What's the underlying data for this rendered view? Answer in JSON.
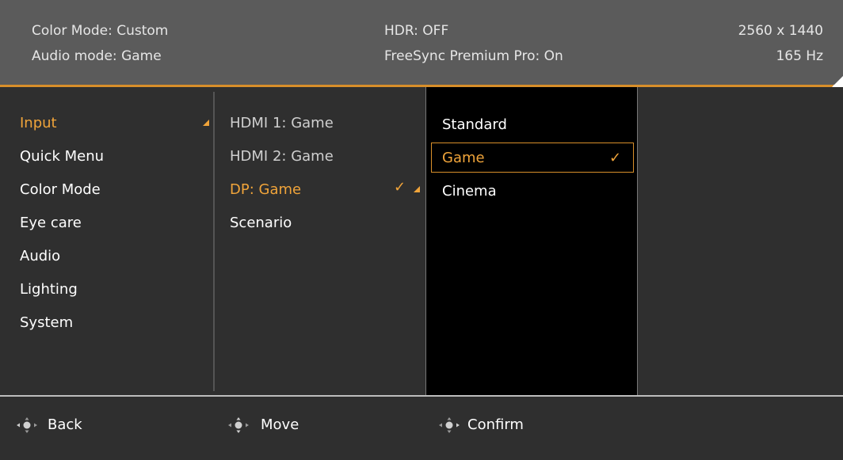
{
  "header": {
    "color_mode": "Color Mode: Custom",
    "audio_mode": "Audio mode: Game",
    "hdr": "HDR: OFF",
    "freesync": "FreeSync Premium Pro: On",
    "resolution": "2560 x 1440",
    "refresh_rate": "165 Hz"
  },
  "main_menu": {
    "items": [
      {
        "label": "Input",
        "active": true
      },
      {
        "label": "Quick Menu"
      },
      {
        "label": "Color Mode"
      },
      {
        "label": "Eye care"
      },
      {
        "label": "Audio"
      },
      {
        "label": "Lighting"
      },
      {
        "label": "System"
      }
    ]
  },
  "submenu": {
    "items": [
      {
        "label": "HDMI 1: Game"
      },
      {
        "label": "HDMI 2: Game"
      },
      {
        "label": "DP: Game",
        "active": true
      },
      {
        "label": "Scenario"
      }
    ]
  },
  "options": {
    "items": [
      {
        "label": "Standard"
      },
      {
        "label": "Game",
        "selected": true
      },
      {
        "label": "Cinema"
      }
    ]
  },
  "footer": {
    "back": "Back",
    "move": "Move",
    "confirm": "Confirm"
  },
  "colors": {
    "accent": "#f0a43a",
    "header_bg": "#5b5b5b",
    "panel_bg": "#2f2f2f",
    "option_bg": "#000000"
  },
  "icons": {
    "joystick": "joystick-icon",
    "check": "check-icon",
    "submenu_arrow": "triangle-icon"
  }
}
